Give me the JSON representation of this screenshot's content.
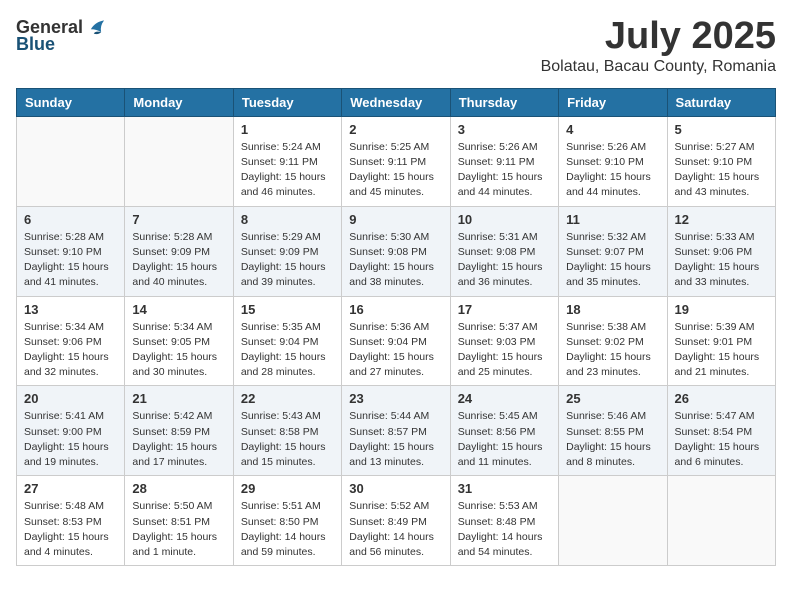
{
  "logo": {
    "general": "General",
    "blue": "Blue"
  },
  "title": {
    "month_year": "July 2025",
    "location": "Bolatau, Bacau County, Romania"
  },
  "weekdays": [
    "Sunday",
    "Monday",
    "Tuesday",
    "Wednesday",
    "Thursday",
    "Friday",
    "Saturday"
  ],
  "weeks": [
    [
      {
        "day": "",
        "info": ""
      },
      {
        "day": "",
        "info": ""
      },
      {
        "day": "1",
        "info": "Sunrise: 5:24 AM\nSunset: 9:11 PM\nDaylight: 15 hours\nand 46 minutes."
      },
      {
        "day": "2",
        "info": "Sunrise: 5:25 AM\nSunset: 9:11 PM\nDaylight: 15 hours\nand 45 minutes."
      },
      {
        "day": "3",
        "info": "Sunrise: 5:26 AM\nSunset: 9:11 PM\nDaylight: 15 hours\nand 44 minutes."
      },
      {
        "day": "4",
        "info": "Sunrise: 5:26 AM\nSunset: 9:10 PM\nDaylight: 15 hours\nand 44 minutes."
      },
      {
        "day": "5",
        "info": "Sunrise: 5:27 AM\nSunset: 9:10 PM\nDaylight: 15 hours\nand 43 minutes."
      }
    ],
    [
      {
        "day": "6",
        "info": "Sunrise: 5:28 AM\nSunset: 9:10 PM\nDaylight: 15 hours\nand 41 minutes."
      },
      {
        "day": "7",
        "info": "Sunrise: 5:28 AM\nSunset: 9:09 PM\nDaylight: 15 hours\nand 40 minutes."
      },
      {
        "day": "8",
        "info": "Sunrise: 5:29 AM\nSunset: 9:09 PM\nDaylight: 15 hours\nand 39 minutes."
      },
      {
        "day": "9",
        "info": "Sunrise: 5:30 AM\nSunset: 9:08 PM\nDaylight: 15 hours\nand 38 minutes."
      },
      {
        "day": "10",
        "info": "Sunrise: 5:31 AM\nSunset: 9:08 PM\nDaylight: 15 hours\nand 36 minutes."
      },
      {
        "day": "11",
        "info": "Sunrise: 5:32 AM\nSunset: 9:07 PM\nDaylight: 15 hours\nand 35 minutes."
      },
      {
        "day": "12",
        "info": "Sunrise: 5:33 AM\nSunset: 9:06 PM\nDaylight: 15 hours\nand 33 minutes."
      }
    ],
    [
      {
        "day": "13",
        "info": "Sunrise: 5:34 AM\nSunset: 9:06 PM\nDaylight: 15 hours\nand 32 minutes."
      },
      {
        "day": "14",
        "info": "Sunrise: 5:34 AM\nSunset: 9:05 PM\nDaylight: 15 hours\nand 30 minutes."
      },
      {
        "day": "15",
        "info": "Sunrise: 5:35 AM\nSunset: 9:04 PM\nDaylight: 15 hours\nand 28 minutes."
      },
      {
        "day": "16",
        "info": "Sunrise: 5:36 AM\nSunset: 9:04 PM\nDaylight: 15 hours\nand 27 minutes."
      },
      {
        "day": "17",
        "info": "Sunrise: 5:37 AM\nSunset: 9:03 PM\nDaylight: 15 hours\nand 25 minutes."
      },
      {
        "day": "18",
        "info": "Sunrise: 5:38 AM\nSunset: 9:02 PM\nDaylight: 15 hours\nand 23 minutes."
      },
      {
        "day": "19",
        "info": "Sunrise: 5:39 AM\nSunset: 9:01 PM\nDaylight: 15 hours\nand 21 minutes."
      }
    ],
    [
      {
        "day": "20",
        "info": "Sunrise: 5:41 AM\nSunset: 9:00 PM\nDaylight: 15 hours\nand 19 minutes."
      },
      {
        "day": "21",
        "info": "Sunrise: 5:42 AM\nSunset: 8:59 PM\nDaylight: 15 hours\nand 17 minutes."
      },
      {
        "day": "22",
        "info": "Sunrise: 5:43 AM\nSunset: 8:58 PM\nDaylight: 15 hours\nand 15 minutes."
      },
      {
        "day": "23",
        "info": "Sunrise: 5:44 AM\nSunset: 8:57 PM\nDaylight: 15 hours\nand 13 minutes."
      },
      {
        "day": "24",
        "info": "Sunrise: 5:45 AM\nSunset: 8:56 PM\nDaylight: 15 hours\nand 11 minutes."
      },
      {
        "day": "25",
        "info": "Sunrise: 5:46 AM\nSunset: 8:55 PM\nDaylight: 15 hours\nand 8 minutes."
      },
      {
        "day": "26",
        "info": "Sunrise: 5:47 AM\nSunset: 8:54 PM\nDaylight: 15 hours\nand 6 minutes."
      }
    ],
    [
      {
        "day": "27",
        "info": "Sunrise: 5:48 AM\nSunset: 8:53 PM\nDaylight: 15 hours\nand 4 minutes."
      },
      {
        "day": "28",
        "info": "Sunrise: 5:50 AM\nSunset: 8:51 PM\nDaylight: 15 hours\nand 1 minute."
      },
      {
        "day": "29",
        "info": "Sunrise: 5:51 AM\nSunset: 8:50 PM\nDaylight: 14 hours\nand 59 minutes."
      },
      {
        "day": "30",
        "info": "Sunrise: 5:52 AM\nSunset: 8:49 PM\nDaylight: 14 hours\nand 56 minutes."
      },
      {
        "day": "31",
        "info": "Sunrise: 5:53 AM\nSunset: 8:48 PM\nDaylight: 14 hours\nand 54 minutes."
      },
      {
        "day": "",
        "info": ""
      },
      {
        "day": "",
        "info": ""
      }
    ]
  ]
}
